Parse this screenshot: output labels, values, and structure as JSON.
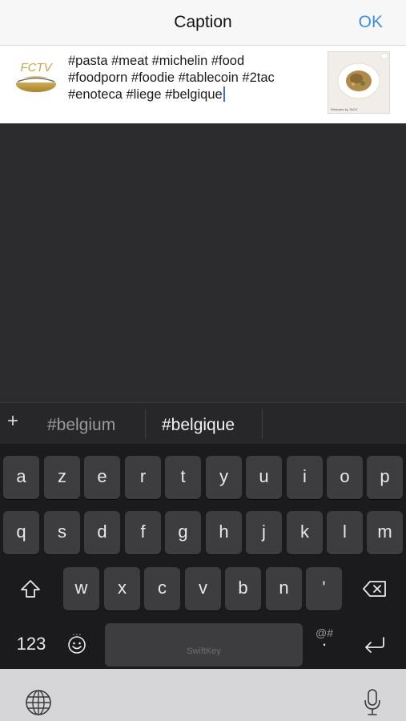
{
  "header": {
    "title": "Caption",
    "ok_label": "OK"
  },
  "caption": {
    "logo_text": "FCTV",
    "text": "#pasta #meat #michelin #food\n#foodporn #foodie #tablecoin #2tac\n#enoteca #liege #belgique",
    "thumbnail_caption": "Welcome by TAOY"
  },
  "suggestions": {
    "plus": "+",
    "items": [
      "#belgium",
      "#belgique"
    ]
  },
  "keyboard": {
    "row1": [
      "a",
      "z",
      "e",
      "r",
      "t",
      "y",
      "u",
      "i",
      "o",
      "p"
    ],
    "row2": [
      "q",
      "s",
      "d",
      "f",
      "g",
      "h",
      "j",
      "k",
      "l",
      "m"
    ],
    "row3": [
      "w",
      "x",
      "c",
      "v",
      "b",
      "n",
      "'"
    ],
    "numbers_key": "123",
    "symbols_hint": "@#",
    "emoji_hint": "...",
    "space_label": "SwiftKey"
  },
  "colors": {
    "accent": "#3b8fe6",
    "key": "#3d3d40",
    "keyboard_bg": "#1b1b1d"
  },
  "icons": [
    "shift-icon",
    "backspace-icon",
    "emoji-icon",
    "return-icon",
    "globe-icon",
    "microphone-icon"
  ]
}
